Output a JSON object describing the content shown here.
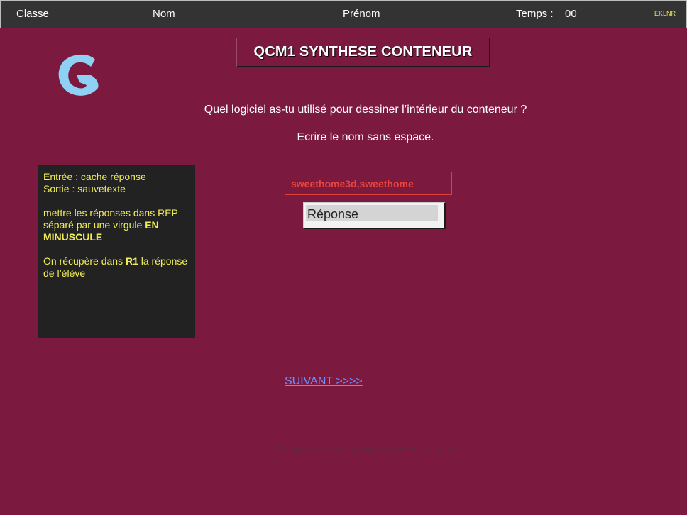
{
  "header": {
    "classe_label": "Classe",
    "nom_label": "Nom",
    "prenom_label": "Prénom",
    "temps_label": "Temps :",
    "temps_value": "00",
    "code": "EKLNR"
  },
  "logo": {
    "icon": "g-logo-icon",
    "color": "#8fd0f5"
  },
  "title": "QCM1 SYNTHESE CONTENEUR",
  "question": "Quel logiciel as-tu utilisé pour dessiner l’intérieur du conteneur ?",
  "instruction": "Ecrire le nom sans espace.",
  "notes": {
    "line1": "Entrée : cache réponse",
    "line2": "Sortie : sauvetexte",
    "para2_start": "mettre les réponses dans REP séparé par une virgule ",
    "para2_bold": "EN MINUSCULE",
    "para3_start": "On récupère dans ",
    "para3_bold": "R1",
    "para3_end": " la réponse de l’élève"
  },
  "answer_key": "sweethome3d,sweethome",
  "answer_input": {
    "value": "",
    "placeholder": "Réponse"
  },
  "next_link": "SUIVANT >>>>",
  "warning": "Attention il n'est pas possible de revenir en arrière",
  "colors": {
    "background": "#7b1a3e",
    "topbar": "#333333",
    "notes_text": "#f2ee55",
    "answer_key": "#e8443c",
    "link": "#6f8dff"
  }
}
